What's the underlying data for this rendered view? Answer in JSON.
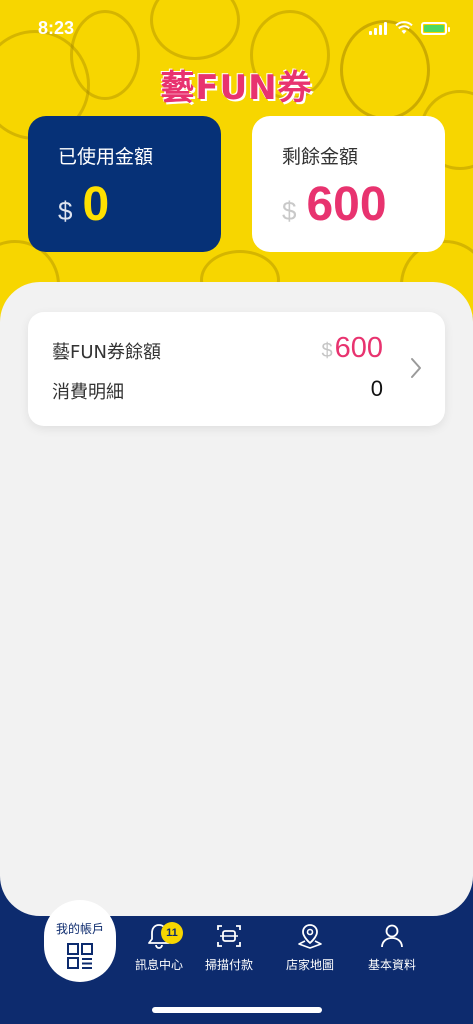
{
  "status_bar": {
    "time": "8:23"
  },
  "logo": {
    "text": "藝FUN券"
  },
  "summary": {
    "used": {
      "title": "已使用金額",
      "currency": "$",
      "value": "0"
    },
    "remaining": {
      "title": "剩餘金額",
      "currency": "$",
      "value": "600"
    }
  },
  "balance_card": {
    "balance_label": "藝FUN券餘額",
    "balance_currency": "$",
    "balance_value": "600",
    "detail_label": "消費明細",
    "detail_count": "0"
  },
  "tabbar": {
    "active": {
      "label": "我的帳戶",
      "icon": "qr-account-icon"
    },
    "tabs": [
      {
        "label": "訊息中心",
        "icon": "bell-icon",
        "badge": "11"
      },
      {
        "label": "掃描付款",
        "icon": "scan-icon"
      },
      {
        "label": "店家地圖",
        "icon": "map-pin-icon"
      },
      {
        "label": "基本資料",
        "icon": "user-icon"
      }
    ]
  },
  "colors": {
    "header_yellow": "#f7d600",
    "navy": "#0d2b6e",
    "card_navy": "#063177",
    "accent_pink": "#e8336f",
    "value_yellow": "#ffe000"
  }
}
